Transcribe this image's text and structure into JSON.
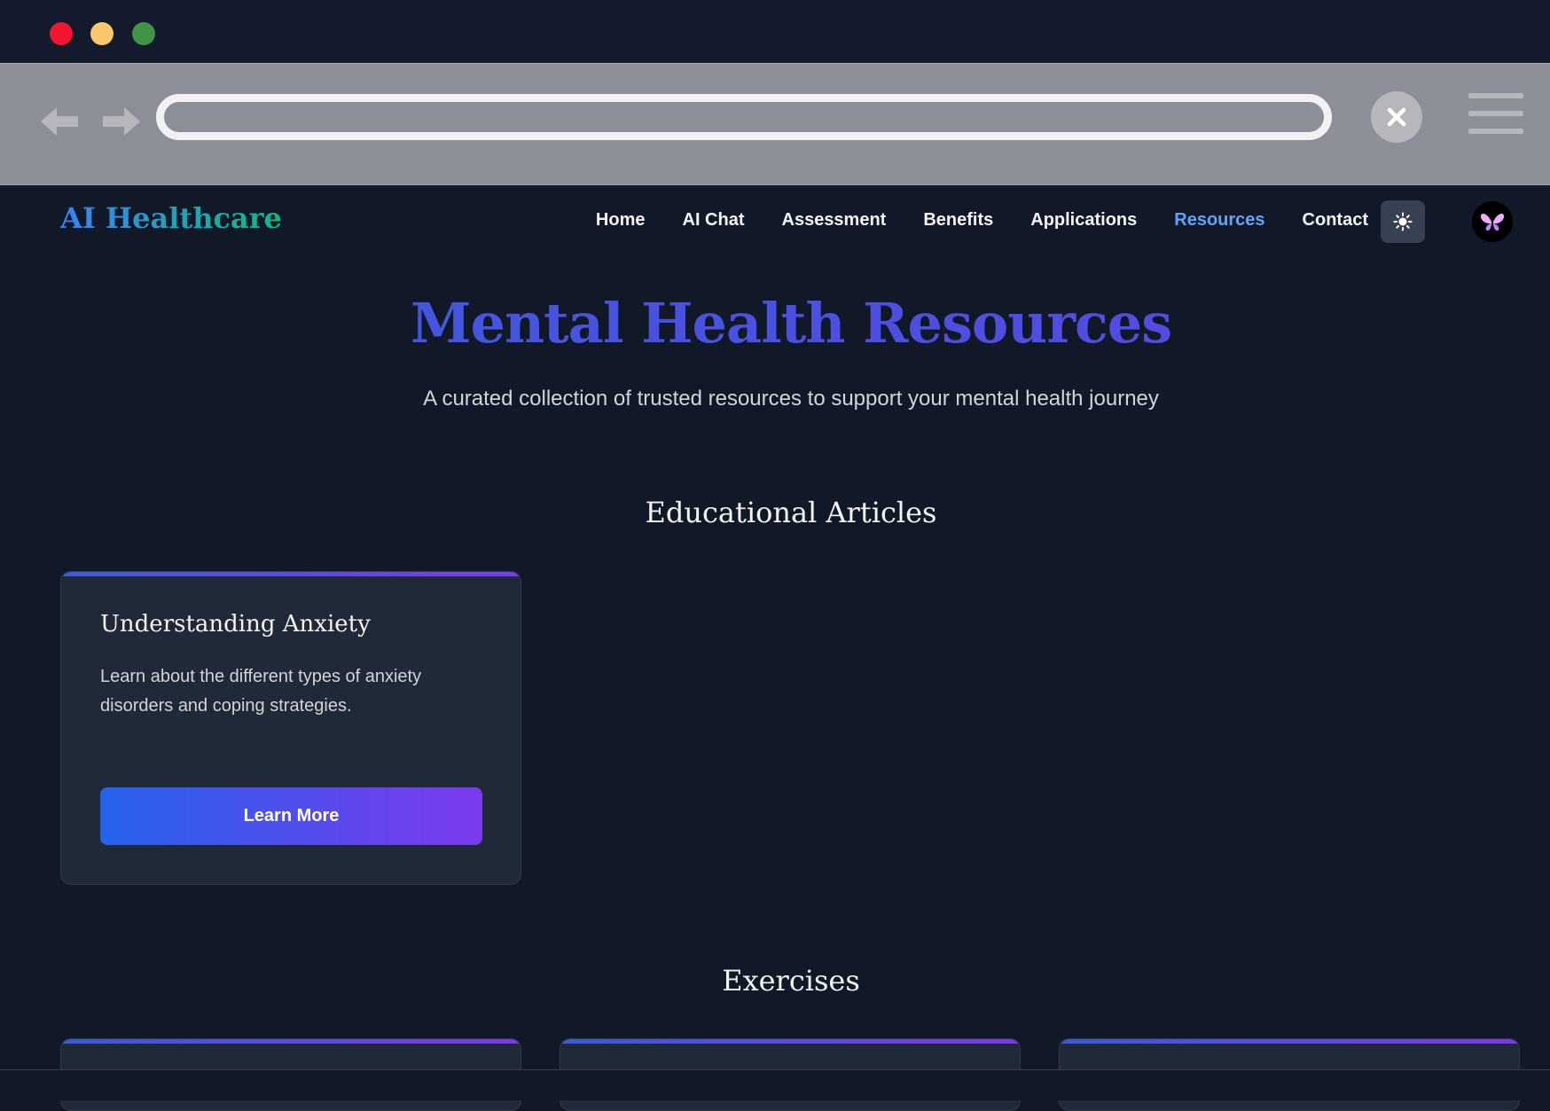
{
  "window": {
    "controls": [
      "close",
      "minimize",
      "maximize"
    ]
  },
  "browser": {
    "url": ""
  },
  "header": {
    "logo": "AI Healthcare",
    "nav": [
      {
        "label": "Home",
        "active": false
      },
      {
        "label": "AI Chat",
        "active": false
      },
      {
        "label": "Assessment",
        "active": false
      },
      {
        "label": "Benefits",
        "active": false
      },
      {
        "label": "Applications",
        "active": false
      },
      {
        "label": "Resources",
        "active": true
      },
      {
        "label": "Contact",
        "active": false
      }
    ],
    "theme_toggle_icon": "sun-icon",
    "avatar_icon": "butterfly-icon"
  },
  "hero": {
    "title": "Mental Health Resources",
    "subtitle": "A curated collection of trusted resources to support your mental health journey"
  },
  "sections": {
    "articles": {
      "title": "Educational Articles",
      "cards": [
        {
          "title": "Understanding Anxiety",
          "description": "Learn about the different types of anxiety disorders and coping strategies.",
          "button": "Learn More"
        }
      ]
    },
    "exercises": {
      "title": "Exercises"
    }
  },
  "colors": {
    "background": "#111827",
    "card": "#1f2937",
    "accent_start": "#2563eb",
    "accent_end": "#7c3aed",
    "active_nav": "#60a5fa"
  }
}
